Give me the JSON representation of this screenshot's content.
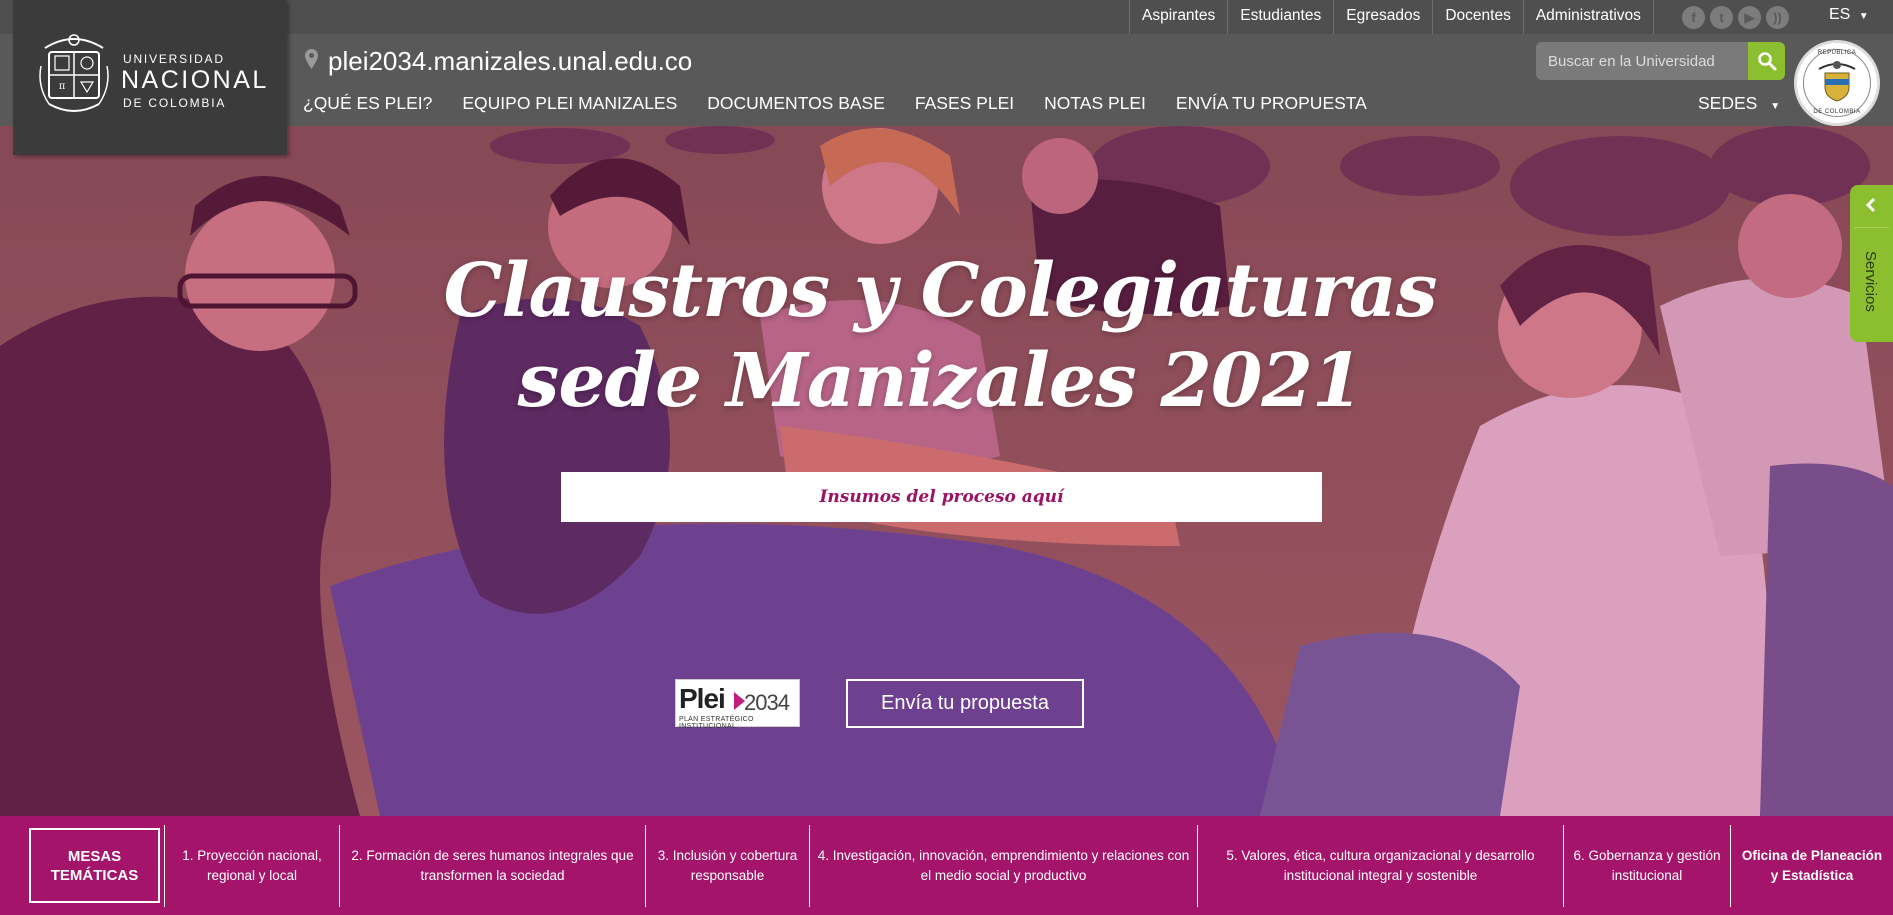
{
  "brand": {
    "line1": "UNIVERSIDAD",
    "line2": "NACIONAL",
    "line3": "DE COLOMBIA"
  },
  "top_links": [
    "Aspirantes",
    "Estudiantes",
    "Egresados",
    "Docentes",
    "Administrativos"
  ],
  "social_icons": [
    "facebook-icon",
    "twitter-icon",
    "youtube-icon",
    "rss-icon"
  ],
  "language": "ES",
  "site_url": "plei2034.manizales.unal.edu.co",
  "nav": [
    "¿QUÉ ES PLEI?",
    "EQUIPO PLEI MANIZALES",
    "DOCUMENTOS BASE",
    "FASES PLEI",
    "NOTAS PLEI",
    "ENVÍA TU PROPUESTA"
  ],
  "sedes_label": "SEDES",
  "search": {
    "placeholder": "Buscar en la Universidad"
  },
  "escudo": {
    "top": "REPÚBLICA",
    "bottom": "DE COLOMBIA"
  },
  "hero": {
    "title_line1": "Claustros y Colegiaturas",
    "title_line2": "sede Manizales 2021",
    "cta_primary": "Insumos del proceso aquí",
    "cta_secondary": "Envía tu propuesta",
    "plei_logo": {
      "word": "Plei",
      "year": "2034",
      "tagline": "PLAN ESTRATÉGICO INSTITUCIONAL"
    }
  },
  "servicios": "Servicios",
  "mesas_label": "MESAS TEMÁTICAS",
  "mesas": [
    "1. Proyección nacional, regional y local",
    "2. Formación de seres humanos integrales que transformen la sociedad",
    "3. Inclusión y cobertura responsable",
    "4. Investigación, innovación, emprendimiento y relaciones con el medio social y productivo",
    "5. Valores, ética, cultura organizacional y desarrollo institucional integral y sostenible",
    "6. Gobernanza y gestión institucional",
    "Oficina de Planeación y Estadística"
  ],
  "colors": {
    "header_bg": "#595959",
    "accent_green": "#8bbf2f",
    "magenta": "#a4146a"
  }
}
